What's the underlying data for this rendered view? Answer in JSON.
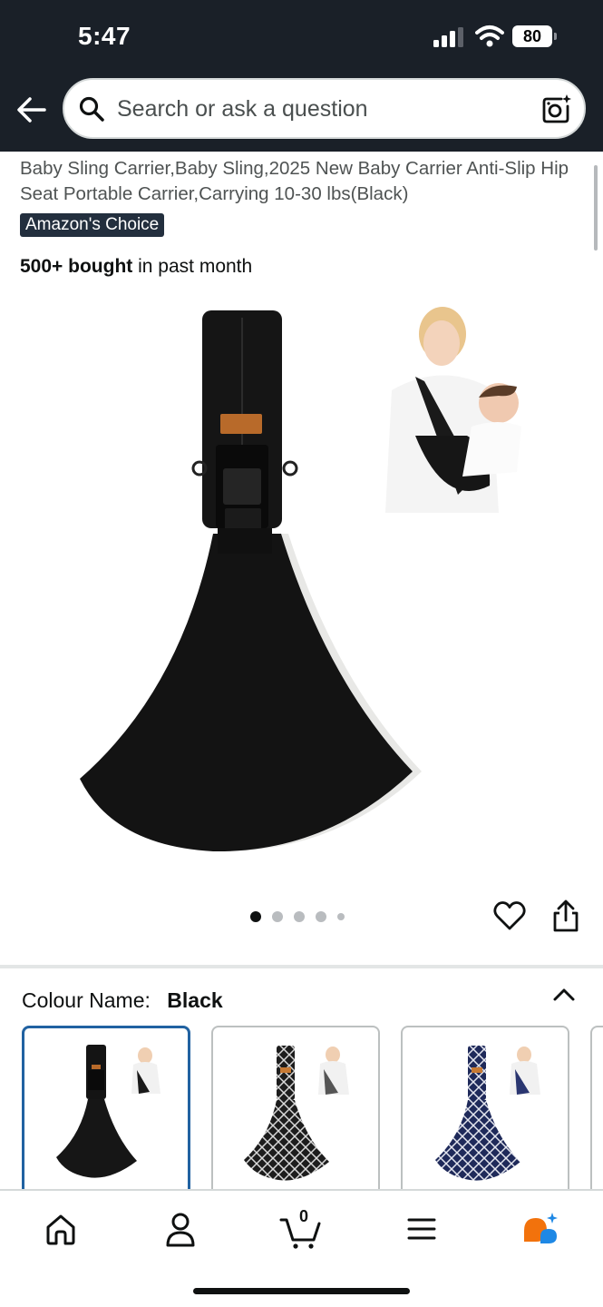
{
  "status_bar": {
    "time": "5:47",
    "battery": "80"
  },
  "header": {
    "search_placeholder": "Search or ask a question"
  },
  "product": {
    "title": "Baby Sling Carrier,Baby Sling,2025 New Baby Carrier Anti-Slip Hip Seat Portable Carrier,Carrying 10-30 lbs(Black)",
    "badge": "Amazon's Choice",
    "bought_bold": "500+ bought",
    "bought_rest": " in past month",
    "image_count": 5,
    "active_image_index": 0
  },
  "variations": {
    "label": "Colour Name:",
    "selected_value": "Black",
    "swatches": [
      {
        "name": "Black",
        "color": "#111111",
        "selected": true
      },
      {
        "name": "Black pattern",
        "color": "#2a2a2a",
        "selected": false
      },
      {
        "name": "Navy pattern",
        "color": "#1f2a5a",
        "selected": false
      }
    ]
  },
  "bottom_nav": {
    "items": [
      {
        "icon": "home-icon"
      },
      {
        "icon": "account-icon"
      },
      {
        "icon": "cart-icon",
        "count": "0"
      },
      {
        "icon": "menu-icon"
      },
      {
        "icon": "rufus-assistant-icon"
      }
    ]
  },
  "colors": {
    "header_bg": "#1a2028",
    "badge_bg": "#232f3e",
    "selected_border": "#2162a1",
    "assistant_orange": "#f2720c",
    "assistant_blue": "#1e88e5"
  }
}
